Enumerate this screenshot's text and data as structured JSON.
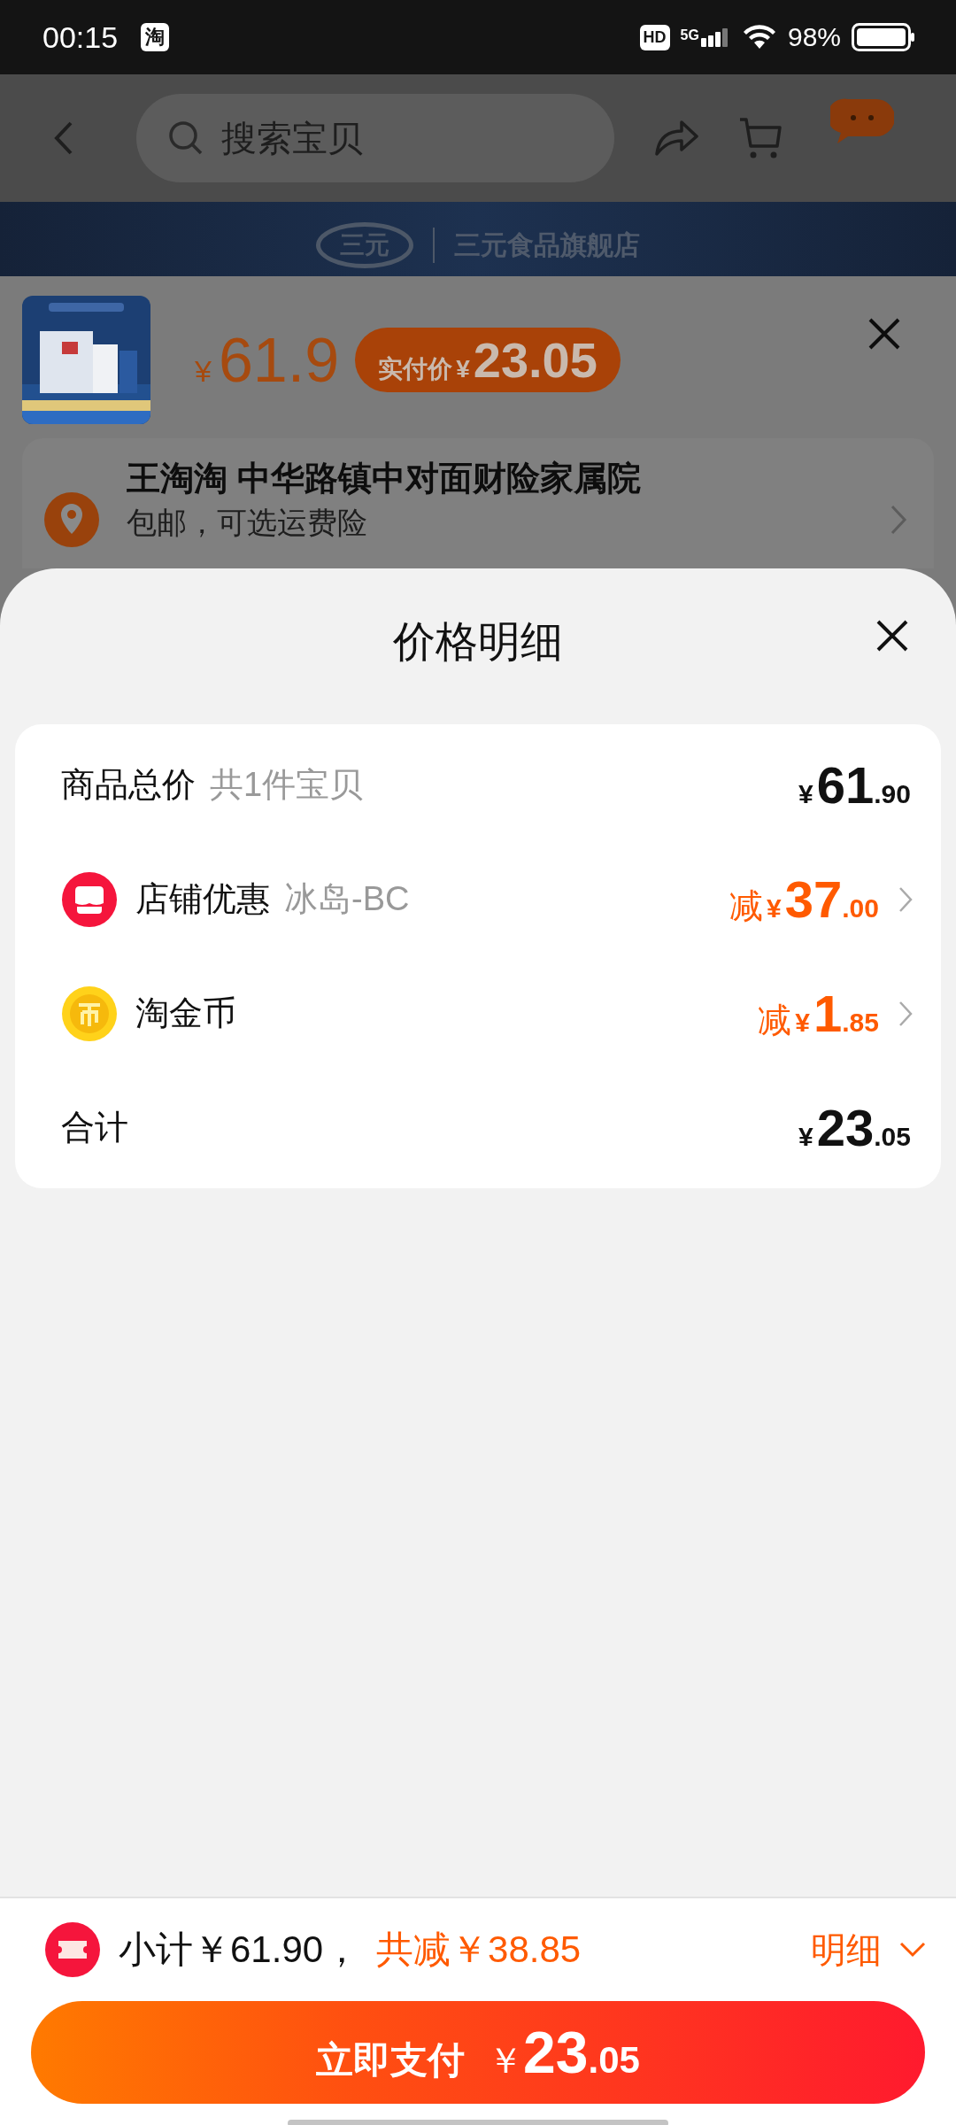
{
  "status_bar": {
    "time": "00:15",
    "app_badge": "淘",
    "hd": "HD",
    "network": "5G",
    "battery": "98%"
  },
  "nav": {
    "search": {
      "placeholder": "搜索宝贝"
    }
  },
  "store_banner": {
    "logo_text": "三元",
    "name": "三元食品旗舰店"
  },
  "product": {
    "price_symbol": "¥",
    "price": "61.9",
    "paid_label": "实付价",
    "paid_symbol": "¥",
    "paid_amount": "23.05"
  },
  "address": {
    "title": "王淘淘 中华路镇中对面财险家属院",
    "note": "包邮，可选运费险"
  },
  "sheet": {
    "title": "价格明细",
    "rows": [
      {
        "kind": "total",
        "label": "商品总价",
        "sub": "共1件宝贝",
        "symbol": "¥",
        "whole": "61",
        "cents": ".90"
      },
      {
        "kind": "shop",
        "label": "店铺优惠",
        "sub": "冰岛-BC",
        "prefix": "减",
        "symbol": "¥",
        "whole": "37",
        "cents": ".00"
      },
      {
        "kind": "coin",
        "label": "淘金币",
        "prefix": "减",
        "symbol": "¥",
        "whole": "1",
        "cents": ".85"
      },
      {
        "kind": "sum",
        "label": "合计",
        "symbol": "¥",
        "whole": "23",
        "cents": ".05"
      }
    ]
  },
  "pay_bar": {
    "subtotal": "小计￥61.90，",
    "discount": "共减￥38.85",
    "details": "明细",
    "button": {
      "label": "立即支付",
      "symbol": "￥",
      "whole": "23",
      "cents": ".05"
    }
  }
}
